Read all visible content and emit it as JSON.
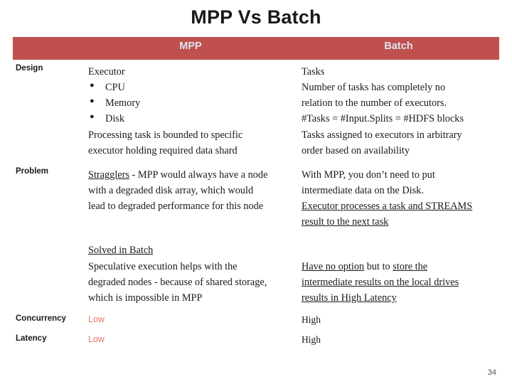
{
  "slide": {
    "title": "MPP Vs Batch",
    "page_number": "34",
    "accent_color": "#c0504d",
    "header_text_color": "#dbe5f1",
    "low_value_color": "#e8766b"
  },
  "header": {
    "mpp": "MPP",
    "batch": "Batch"
  },
  "rows": {
    "design": {
      "label": "Design",
      "mpp": {
        "line1": "Executor",
        "bullets": [
          "CPU",
          "Memory",
          "Disk"
        ],
        "line2": "Processing task is bounded to specific",
        "line3": "executor holding required data shard"
      },
      "batch": {
        "line1": "Tasks",
        "line2": "Number of tasks has completely no",
        "line3": "relation to the number of executors.",
        "line4": "#Tasks = #Input.Splits = #HDFS blocks",
        "line5": "Tasks assigned to executors in arbitrary",
        "line6": "order based on availability"
      }
    },
    "problem": {
      "label": "Problem",
      "mpp": {
        "l1a": "Stragglers",
        "l1b": " - MPP would always have a node",
        "l2": "with a degraded disk array, which would",
        "l3": "lead to degraded performance for this node",
        "l4": "Solved in Batch",
        "l5": "Speculative execution helps with the",
        "l6": "degraded nodes - because of shared storage,",
        "l7": "which is impossible in MPP"
      },
      "batch": {
        "l1": "With MPP, you don’t need to put",
        "l2": "intermediate data on the Disk.",
        "l3": "Executor processes a task and STREAMS",
        "l4": "result to the next task",
        "l5a": "Have no option",
        "l5b": " but to ",
        "l5c": "store the",
        "l6": "intermediate results on the local drives",
        "l7": "results in High Latency"
      }
    },
    "concurrency": {
      "label": "Concurrency",
      "mpp": "Low",
      "batch": "High"
    },
    "latency": {
      "label": "Latency",
      "mpp": "Low",
      "batch": "High"
    }
  }
}
